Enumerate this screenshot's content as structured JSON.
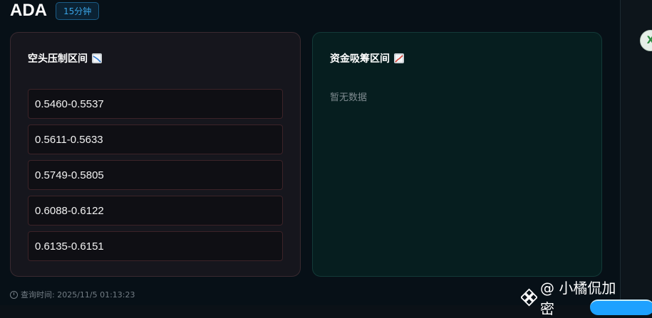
{
  "header": {
    "ticker": "ADA",
    "interval_badge": "15分钟"
  },
  "bear_card": {
    "title": "空头压制区间",
    "icon": "chart-decreasing-icon",
    "zones": [
      "0.5460-0.5537",
      "0.5611-0.5633",
      "0.5749-0.5805",
      "0.6088-0.6122",
      "0.6135-0.6151"
    ]
  },
  "bull_card": {
    "title": "资金吸筹区间",
    "icon": "chart-increasing-icon",
    "empty_text": "暂无数据"
  },
  "footer": {
    "query_time": "查询时间: 2025/11/5 01:13:23"
  },
  "watermark": {
    "handle": "@ 小橘侃加密"
  },
  "colors": {
    "bear_border": "#3c2328",
    "bull_bg": "#061e1f",
    "badge": "#3aa4e6"
  }
}
